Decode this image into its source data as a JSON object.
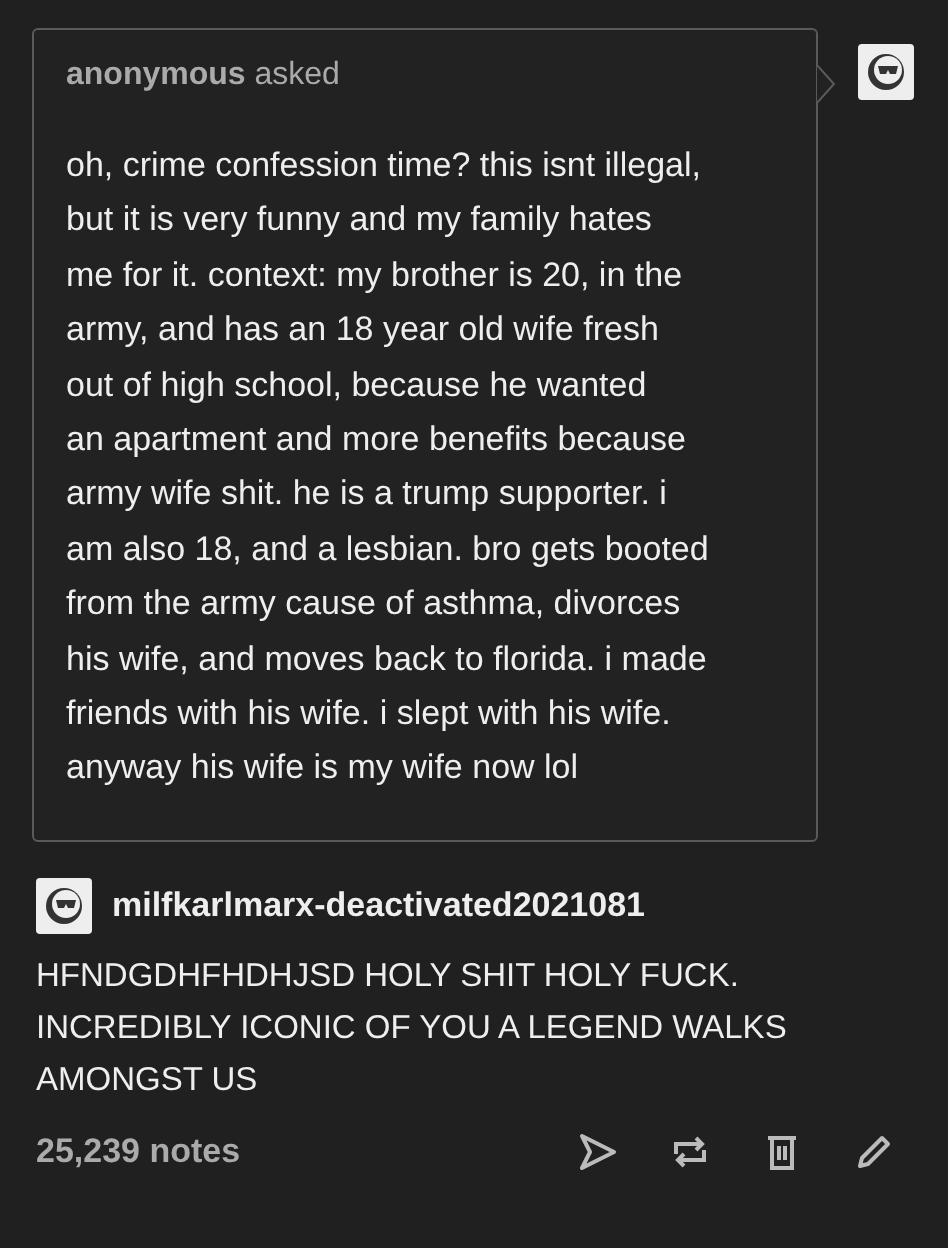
{
  "ask": {
    "asker": "anonymous",
    "verb": "asked",
    "question_lines": [
      "oh, crime confession time? this isnt illegal,",
      "but it is very funny and my family hates",
      "me for it. context: my brother is 20, in the",
      "army, and has an 18 year old wife fresh",
      "out of high school, because he wanted",
      "an apartment and more benefits because",
      "army wife shit. he is a trump supporter. i",
      "am also 18, and a lesbian. bro gets booted",
      "from the army cause of asthma, divorces",
      "his wife, and moves back to florida. i made",
      "friends with his wife. i slept with his wife.",
      "anyway his wife is my wife now lol"
    ]
  },
  "reply": {
    "username": "milfkarlmarx-deactivated2021081",
    "body_lines": [
      "HFNDGDHFHDHJSD HOLY SHIT HOLY FUCK.",
      "INCREDIBLY ICONIC OF YOU A LEGEND WALKS",
      "AMONGST US"
    ]
  },
  "footer": {
    "notes": "25,239 notes"
  }
}
